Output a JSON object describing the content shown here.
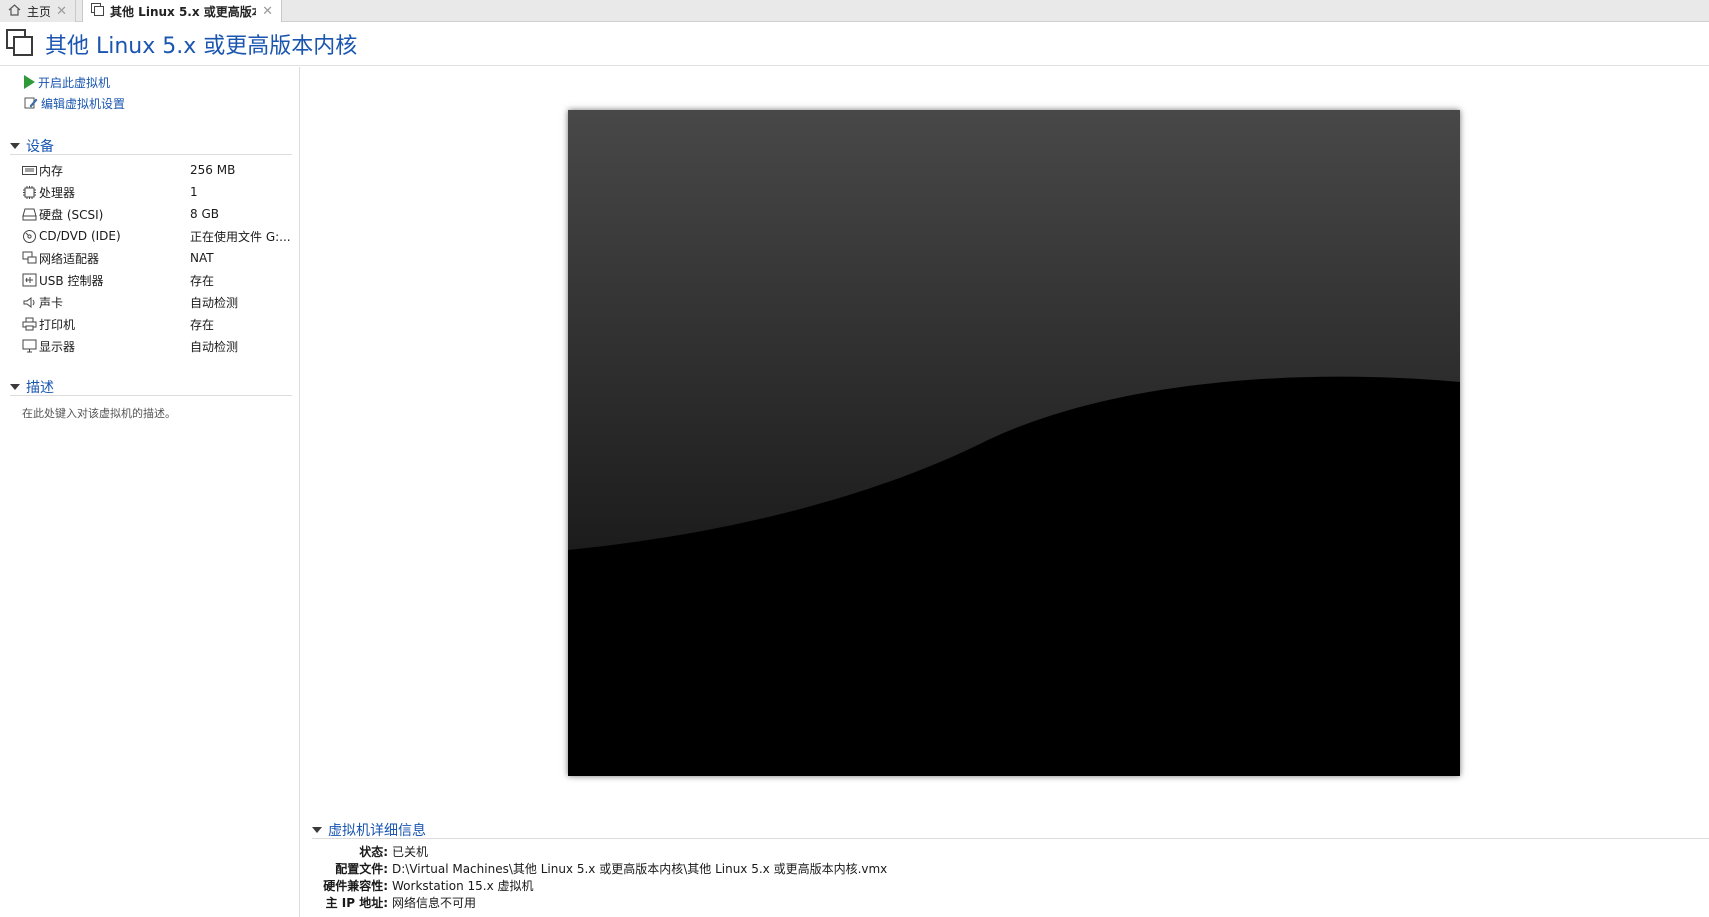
{
  "tabs": [
    {
      "label": "主页",
      "icon": "home-icon"
    },
    {
      "label": "其他 Linux 5.x 或更高版本...",
      "icon": "vm-tab-icon"
    }
  ],
  "header": {
    "title": "其他 Linux 5.x 或更高版本内核"
  },
  "actions": {
    "power_on": "开启此虚拟机",
    "edit_settings": "编辑虚拟机设置"
  },
  "devices_section": {
    "title": "设备",
    "items": [
      {
        "name": "内存",
        "value": "256 MB",
        "icon": "memory-icon"
      },
      {
        "name": "处理器",
        "value": "1",
        "icon": "cpu-icon"
      },
      {
        "name": "硬盘 (SCSI)",
        "value": "8 GB",
        "icon": "hard-disk-icon"
      },
      {
        "name": "CD/DVD (IDE)",
        "value": "正在使用文件 G:...",
        "icon": "cd-dvd-icon"
      },
      {
        "name": "网络适配器",
        "value": "NAT",
        "icon": "network-adapter-icon"
      },
      {
        "name": "USB 控制器",
        "value": "存在",
        "icon": "usb-icon"
      },
      {
        "name": "声卡",
        "value": "自动检测",
        "icon": "sound-card-icon"
      },
      {
        "name": "打印机",
        "value": "存在",
        "icon": "printer-icon"
      },
      {
        "name": "显示器",
        "value": "自动检测",
        "icon": "display-icon"
      }
    ]
  },
  "description_section": {
    "title": "描述",
    "placeholder": "在此处键入对该虚拟机的描述。"
  },
  "details_section": {
    "title": "虚拟机详细信息",
    "rows": [
      {
        "key": "状态:",
        "value": "已关机"
      },
      {
        "key": "配置文件:",
        "value": "D:\\Virtual Machines\\其他 Linux 5.x 或更高版本内核\\其他 Linux 5.x 或更高版本内核.vmx"
      },
      {
        "key": "硬件兼容性:",
        "value": "Workstation 15.x 虚拟机"
      },
      {
        "key": "主 IP 地址:",
        "value": "网络信息不可用"
      }
    ]
  },
  "colors": {
    "link": "#1a56b0",
    "power_on": "#2e9a3a"
  }
}
